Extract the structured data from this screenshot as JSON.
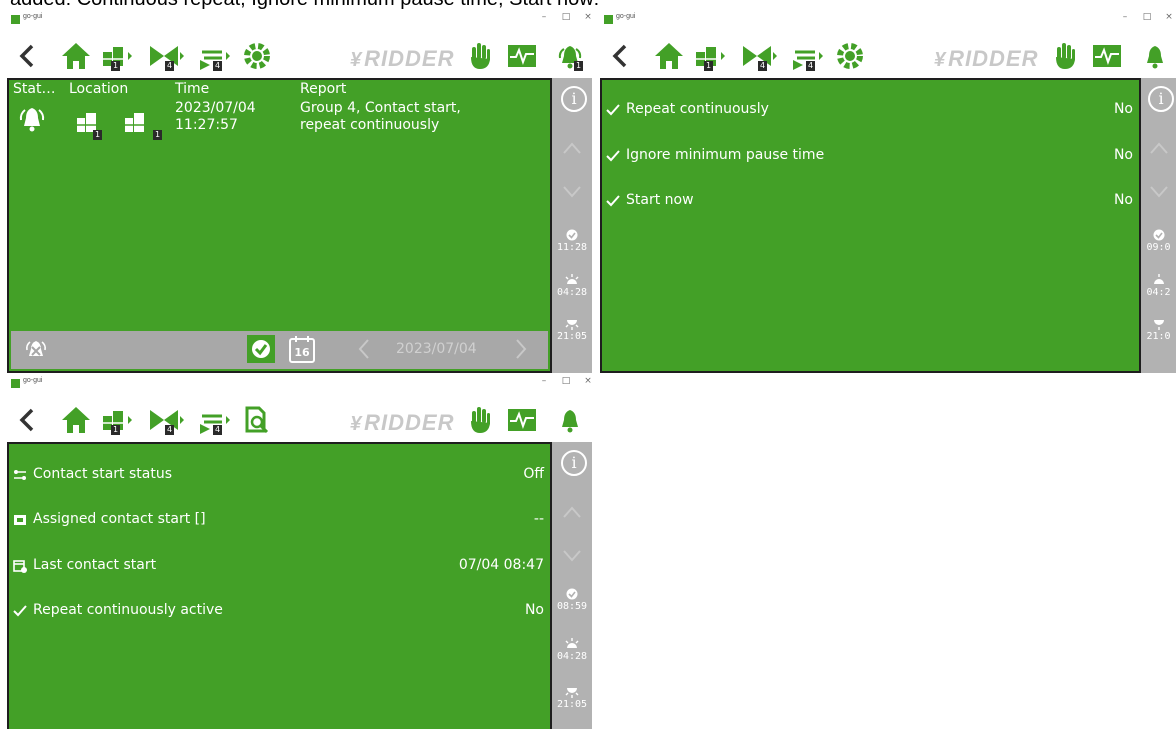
{
  "caption": "added: Continuous repeat, Ignore minimum pause time, Start now:",
  "colors": {
    "accent_green": "#43a027",
    "panel_border": "#1e1e1e",
    "sidebar_grey": "#b2b2b2",
    "ridder_grey": "#c8c8c8"
  },
  "window": {
    "app_title": "go-gui",
    "controls": {
      "minimize": "–",
      "maximize": "□",
      "close": "×"
    }
  },
  "toolbar": {
    "back_icon": "chevron-left-icon",
    "home_icon": "home-icon",
    "greenhouse_badge": "1",
    "valve_badge": "4",
    "tap_badge": "4",
    "settings_icon": "gear-icon",
    "search_icon": "magnify-document-icon",
    "brand": "RIDDER",
    "hand_icon": "hand-icon",
    "graph_icon": "graph-icon",
    "alarm_icon": "bell-icon",
    "alarm_badge": "1"
  },
  "alarm_window": {
    "columns": [
      "Stat…",
      "Location",
      "Time",
      "Report"
    ],
    "rows": [
      {
        "status_icon": "alarm-bell-icon",
        "location_badges": [
          "1",
          "1"
        ],
        "time_date": "2023/07/04",
        "time_clock": "11:27:57",
        "report_line1": "Group 4, Contact start,",
        "report_line2": "repeat continuously"
      }
    ],
    "footer": {
      "date": "2023/07/04",
      "calendar_day": "16"
    },
    "sidebar": {
      "info": "i",
      "time_clock": "11:28",
      "sunrise": "04:28",
      "sunset": "21:05"
    }
  },
  "settings_window": {
    "rows": [
      {
        "label": "Repeat continuously",
        "value": "No"
      },
      {
        "label": "Ignore minimum pause time",
        "value": "No"
      },
      {
        "label": "Start now",
        "value": "No"
      }
    ],
    "sidebar": {
      "info": "i",
      "time_clock": "09:0",
      "sunrise": "04:2",
      "sunset": "21:0"
    }
  },
  "status_window": {
    "rows": [
      {
        "icon": "contact-status-icon",
        "label": "Contact start status",
        "value": "Off"
      },
      {
        "icon": "assigned-contact-icon",
        "label": "Assigned contact start []",
        "value": "--"
      },
      {
        "icon": "calendar-clock-icon",
        "label": "Last contact start",
        "value": "07/04 08:47"
      },
      {
        "icon": "check-icon",
        "label": "Repeat continuously active",
        "value": "No"
      }
    ],
    "sidebar": {
      "info": "i",
      "time_clock": "08:59",
      "sunrise": "04:28",
      "sunset": "21:05"
    }
  }
}
